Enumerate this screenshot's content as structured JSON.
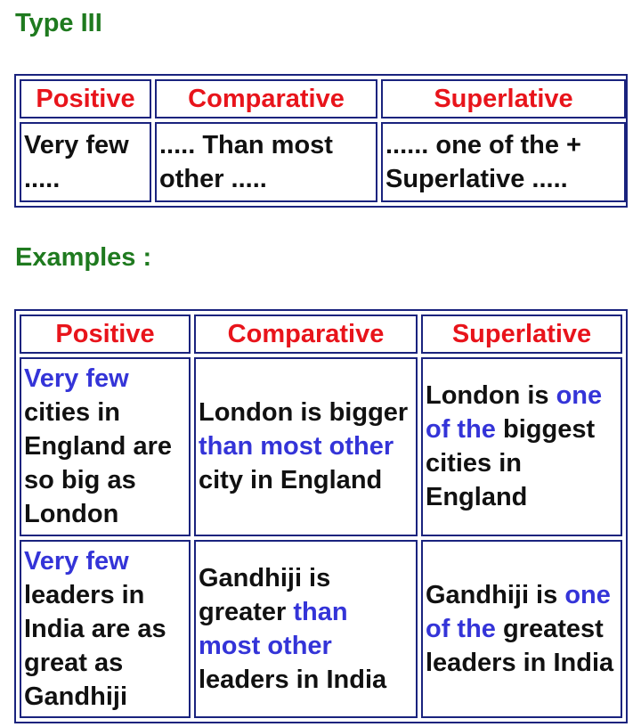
{
  "type_heading": "Type III",
  "examples_heading": "Examples :",
  "colors": {
    "heading": "#1f7a1f",
    "column_header": "#e8141b",
    "highlight": "#3434d8",
    "border": "#1a237e"
  },
  "pattern_table": {
    "headers": [
      "Positive",
      "Comparative",
      "Superlative"
    ],
    "row": [
      "Very few .....",
      "..... Than most other .....",
      "...... one of the + Superlative ....."
    ]
  },
  "examples_table": {
    "headers": [
      "Positive",
      "Comparative",
      "Superlative"
    ],
    "rows": [
      {
        "positive": {
          "highlight": "Very few",
          "rest": " cities in England are so big as London"
        },
        "comparative": {
          "before": "London is bigger ",
          "highlight": "than most other",
          "after": " city in England"
        },
        "superlative": {
          "before": "London is ",
          "highlight": "one of the",
          "after": " biggest cities in England"
        }
      },
      {
        "positive": {
          "highlight": "Very few",
          "rest": " leaders in India are as great as Gandhiji"
        },
        "comparative": {
          "before": "Gandhiji is greater ",
          "highlight": "than most other",
          "after": " leaders in India"
        },
        "superlative": {
          "before": "Gandhiji is ",
          "highlight": "one of the",
          "after": " greatest leaders in India"
        }
      }
    ]
  }
}
